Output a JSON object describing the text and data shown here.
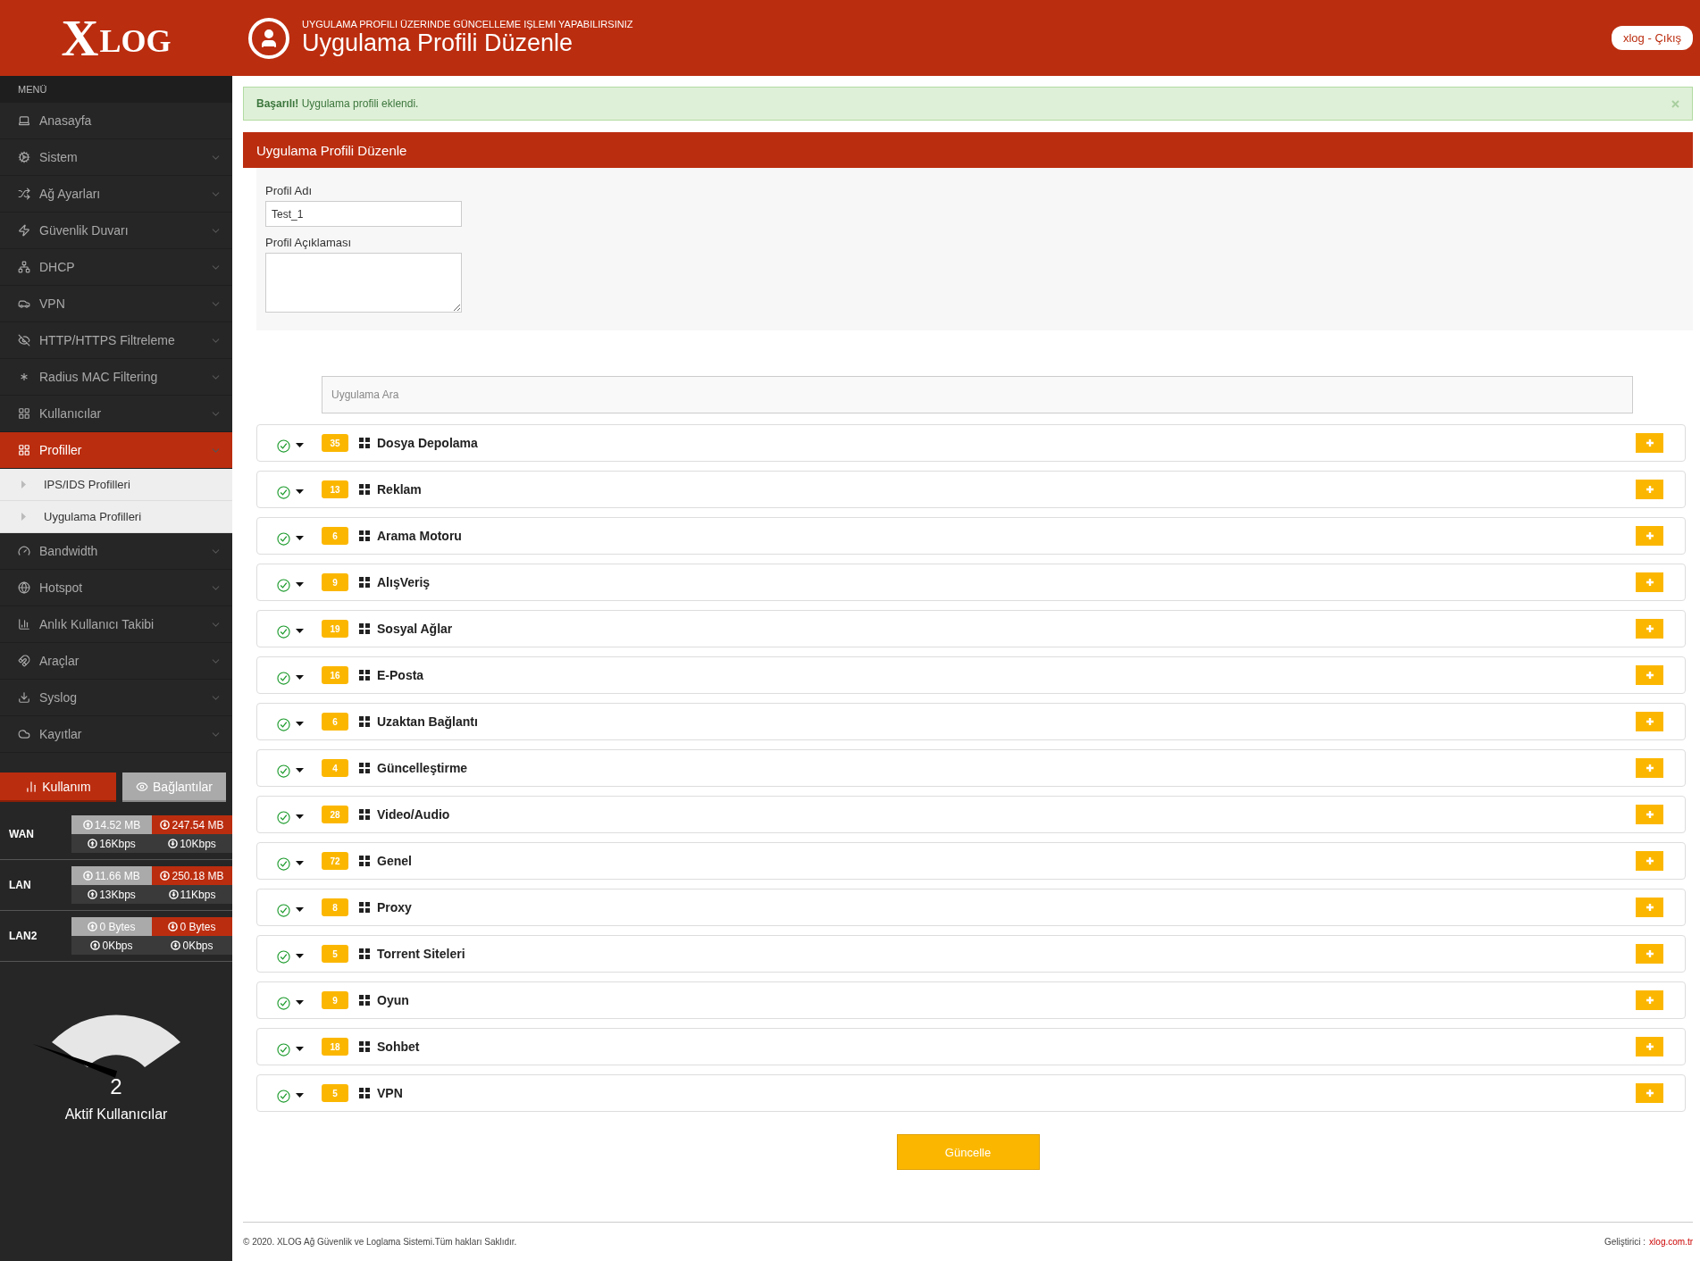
{
  "brand": {
    "mark": "X",
    "text": "LOG"
  },
  "menu_title": "MENÜ",
  "menu": [
    {
      "label": "Anasayfa",
      "kind": "link",
      "selected": false
    },
    {
      "label": "Sistem",
      "kind": "group",
      "selected": false
    },
    {
      "label": "Ağ Ayarları",
      "kind": "group",
      "selected": false
    },
    {
      "label": "Güvenlik Duvarı",
      "kind": "group",
      "selected": false
    },
    {
      "label": "DHCP",
      "kind": "group",
      "selected": false
    },
    {
      "label": "VPN",
      "kind": "group",
      "selected": false
    },
    {
      "label": "HTTP/HTTPS Filtreleme",
      "kind": "group",
      "selected": false
    },
    {
      "label": "Radius MAC Filtering",
      "kind": "group",
      "selected": false
    },
    {
      "label": "Kullanıcılar",
      "kind": "group",
      "selected": false
    },
    {
      "label": "Profiller",
      "kind": "group",
      "selected": true,
      "children": [
        {
          "label": "IPS/IDS Profilleri",
          "selected": false
        },
        {
          "label": "Uygulama Profilleri",
          "selected": false
        }
      ]
    },
    {
      "label": "Bandwidth",
      "kind": "group",
      "selected": false
    },
    {
      "label": "Hotspot",
      "kind": "group",
      "selected": false
    },
    {
      "label": "Anlık Kullanıcı Takibi",
      "kind": "group",
      "selected": false
    },
    {
      "label": "Araçlar",
      "kind": "group",
      "selected": false
    },
    {
      "label": "Syslog",
      "kind": "group",
      "selected": false
    },
    {
      "label": "Kayıtlar",
      "kind": "group",
      "selected": false
    }
  ],
  "stat_tabs": [
    {
      "label": "Kullanım",
      "selected": true
    },
    {
      "label": "Bağlantılar",
      "selected": false
    }
  ],
  "interfaces": [
    {
      "name": "WAN",
      "up_total": "14.52 MB",
      "down_total": "247.54 MB",
      "up_rate": "16Kbps",
      "down_rate": "10Kbps"
    },
    {
      "name": "LAN",
      "up_total": "11.66 MB",
      "down_total": "250.18 MB",
      "up_rate": "13Kbps",
      "down_rate": "11Kbps"
    },
    {
      "name": "LAN2",
      "up_total": "0 Bytes",
      "down_total": "0 Bytes",
      "up_rate": "0Kbps",
      "down_rate": "0Kbps"
    }
  ],
  "active_users": {
    "value": "2",
    "label": "Aktif Kullanıcılar"
  },
  "header": {
    "subtitle": "UYGULAMA PROFILI ÜZERINDE GÜNCELLEME IŞLEMI YAPABILIRSINIZ",
    "title": "Uygulama Profili Düzenle",
    "user_button": "xlog - Çıkış"
  },
  "alert": {
    "text": "**Başarılı!** Uygulama profili eklendi."
  },
  "panel": {
    "title": "Uygulama Profili Düzenle",
    "fields": [
      {
        "label": "Profil Adı",
        "kind": "text",
        "value": "Test_1"
      },
      {
        "label": "Profil Açıklaması",
        "kind": "textarea"
      }
    ]
  },
  "search": {
    "placeholder": "Uygulama Ara"
  },
  "apps": [
    {
      "name": "Dosya Depolama",
      "count": "35",
      "checked": true
    },
    {
      "name": "Reklam",
      "count": "13",
      "checked": true
    },
    {
      "name": "Arama Motoru",
      "count": "6",
      "checked": true
    },
    {
      "name": "AlışVeriş",
      "count": "9",
      "checked": true
    },
    {
      "name": "Sosyal Ağlar",
      "count": "19",
      "checked": true
    },
    {
      "name": "E-Posta",
      "count": "16",
      "checked": true
    },
    {
      "name": "Uzaktan Bağlantı",
      "count": "6",
      "checked": true
    },
    {
      "name": "Güncelleştirme",
      "count": "4",
      "checked": true
    },
    {
      "name": "Video/Audio",
      "count": "28",
      "checked": true
    },
    {
      "name": "Genel",
      "count": "72",
      "checked": true
    },
    {
      "name": "Proxy",
      "count": "8",
      "checked": true
    },
    {
      "name": "Torrent Siteleri",
      "count": "5",
      "checked": true
    },
    {
      "name": "Oyun",
      "count": "9",
      "checked": true
    },
    {
      "name": "Sohbet",
      "count": "18",
      "checked": true
    },
    {
      "name": "VPN",
      "count": "5",
      "checked": true
    }
  ],
  "submit": "Güncelle",
  "footer": {
    "copyright": "© 2020. XLOG Ağ Güvenlik ve Loglama Sistemi.Tüm hakları Saklıdır.",
    "developer_label": "Geliştirici :",
    "developer_link": "xlog.com.tr"
  }
}
